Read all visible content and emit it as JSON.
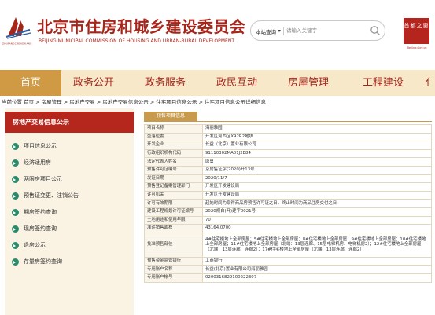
{
  "header": {
    "logo_caption": "ZHUFANGCHENGXIANG",
    "title": "北京市住房和城乡建设委员会",
    "subtitle": "BEIJING MUNICIPAL COMMISSION OF HOUSING AND URBAN-RURAL DEVELOPMENT",
    "search_scope": "本站查询",
    "search_placeholder": "请输入关键字",
    "emblem_text": "首都之窗",
    "emblem_caption": "Beijing.Gov.cn"
  },
  "nav": {
    "items": [
      {
        "label": "首页"
      },
      {
        "label": "政务公开"
      },
      {
        "label": "政务服务"
      },
      {
        "label": "政民互动"
      },
      {
        "label": "房屋管理"
      },
      {
        "label": "工程建设"
      },
      {
        "label": "亻"
      }
    ]
  },
  "breadcrumb": {
    "text": "当前位置 首页 > 房屋管理 > 房地产交易 > 房地产交易信息公示 > 住宅项目信息公示 > 住宅项目信息公示详细信息"
  },
  "sidebar": {
    "title": "房地产交易信息公示",
    "items": [
      {
        "label": "项目信息公示"
      },
      {
        "label": "经济适用房"
      },
      {
        "label": "两限房项目公示"
      },
      {
        "label": "预售证变更、注销公告"
      },
      {
        "label": "期房签约查询"
      },
      {
        "label": "现房签约查询"
      },
      {
        "label": "退房公示"
      },
      {
        "label": "存量房签约查询"
      }
    ]
  },
  "detail": {
    "section_tab": "预售项目信息",
    "rows": [
      {
        "key": "项目名称",
        "value": "海丽雅园"
      },
      {
        "key": "坐落位置",
        "value": "开发区河西区X92R2地块"
      },
      {
        "key": "开发企业",
        "value": "长益（北京）置业有限公司"
      },
      {
        "key": "行政组织机构代码",
        "value": "91110302MA01J2E84"
      },
      {
        "key": "法定代表人姓名",
        "value": "唐勇"
      },
      {
        "key": "预售许可证编号",
        "value": "京房售证字(2020)开13号"
      },
      {
        "key": "发证日期",
        "value": "2020/11/7"
      },
      {
        "key": "预售登记备案管理部门",
        "value": "开发区开发建设局"
      },
      {
        "key": "许可机关",
        "value": "开发区开发建设局"
      },
      {
        "key": "许可有效期限",
        "value": "起始时间为取得商品房预售许可证之日，终止时间为商品住房交付之日"
      },
      {
        "key": "建设工程规划许可证编号",
        "value": "2020规自(开)建字0021号"
      },
      {
        "key": "土地用途和使用年限",
        "value": "70"
      },
      {
        "key": "准许销售面积",
        "value": "43164.0700"
      },
      {
        "key": "批准预售部位",
        "value": "4#住宅楼地上全部房屋；5#住宅楼地上全部房屋；8#住宅楼地上全部房屋；9#住宅楼地上全部房屋；10#住宅楼地上全部房屋；11#住宅楼地上全部房屋（北端：13层连廊、15层电梯机房、电梯机房2）；12#住宅楼地上全部房屋（北端：13层连廊、连廊2）；17#住宅楼地上全部房屋（北端：13层连廊、连廊2）"
      },
      {
        "key": "预售资金监管银行",
        "value": "工商银行"
      },
      {
        "key": "专用账户名称",
        "value": "长益(北京)置业有限公司海丽雅园"
      },
      {
        "key": "专用账户帐号",
        "value": "0200316829100222307"
      }
    ]
  },
  "colors": {
    "brand_red": "#a6261b",
    "nav_bg": "#f6e8c9",
    "nav_active": "#cf9a43",
    "sidebar_title": "#b5261d",
    "bullet_green": "#2a8b6b"
  }
}
